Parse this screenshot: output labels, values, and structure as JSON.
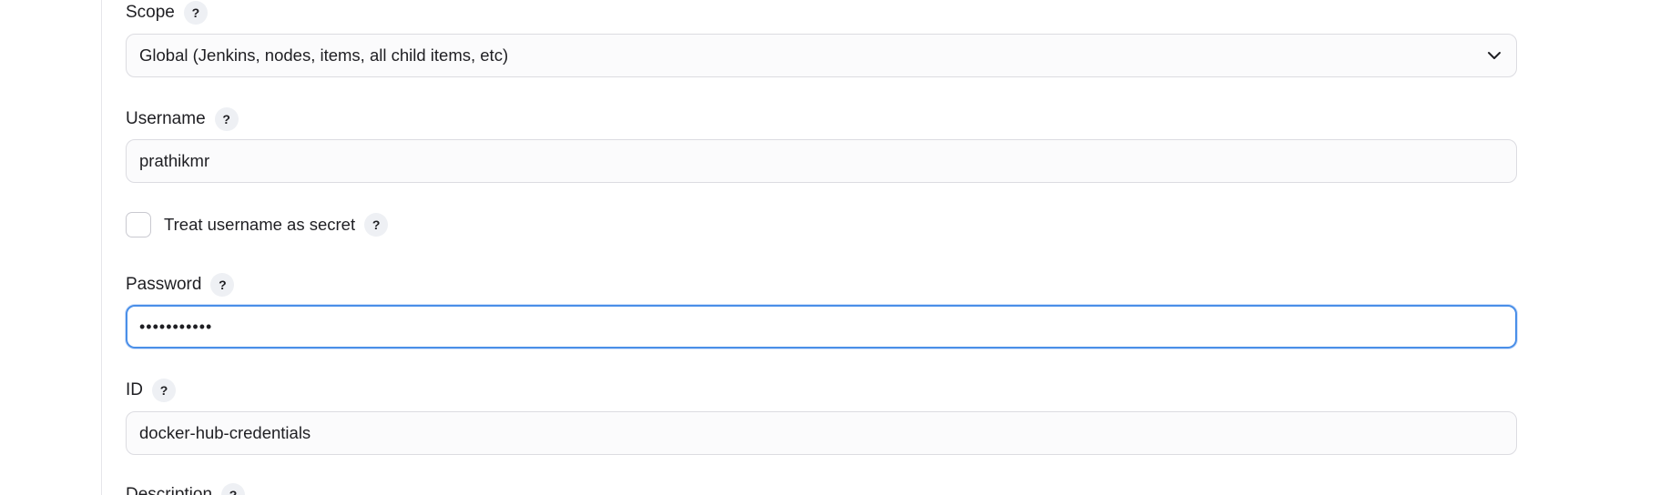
{
  "form": {
    "scope": {
      "label": "Scope",
      "help": "?",
      "selected": "Global (Jenkins, nodes, items, all child items, etc)",
      "chevron_icon": "chevron-down-icon"
    },
    "username": {
      "label": "Username",
      "help": "?",
      "value": "prathikmr"
    },
    "treat_secret": {
      "label": "Treat username as secret",
      "help": "?",
      "checked": false
    },
    "password": {
      "label": "Password",
      "help": "?",
      "masked_value": "•••••••••••"
    },
    "id": {
      "label": "ID",
      "help": "?",
      "value": "docker-hub-credentials"
    },
    "description": {
      "label": "Description",
      "help": "?"
    }
  },
  "colors": {
    "focus_border": "#4a8fe8",
    "input_border": "#dcdce1",
    "input_bg": "#fbfbfc",
    "help_bg": "#eef0f4"
  }
}
